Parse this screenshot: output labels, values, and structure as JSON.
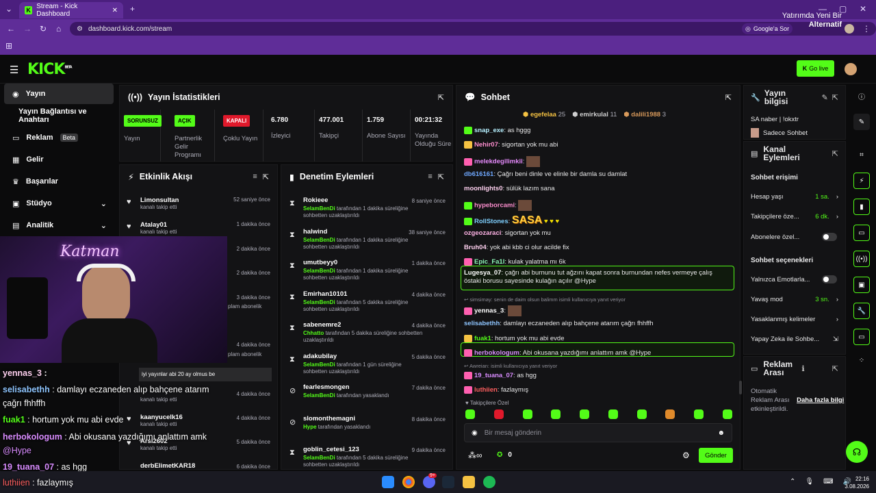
{
  "browser": {
    "tab_title": "Stream - Kick Dashboard",
    "url": "dashboard.kick.com/stream",
    "google_search": "Google'a Sor",
    "promo_line1": "Yatırımda Yeni Bir",
    "promo_line2": "Alternatif"
  },
  "header": {
    "logo": "KICK",
    "beta": "BETA",
    "go_live": "Go live"
  },
  "sidebar": {
    "items": [
      {
        "label": "Yayın"
      },
      {
        "label": "Yayın Bağlantısı ve Anahtarı"
      },
      {
        "label": "Reklam",
        "badge": "Beta"
      },
      {
        "label": "Gelir"
      },
      {
        "label": "Başarılar"
      },
      {
        "label": "Stüdyo"
      },
      {
        "label": "Analitik"
      }
    ]
  },
  "stats": {
    "title": "Yayın İstatistikleri",
    "cols": [
      {
        "value": "SORUNSUZ",
        "label": "Yayın"
      },
      {
        "value": "AÇIK",
        "label": "Partnerlik Gelir Programı"
      },
      {
        "value": "KAPALI",
        "label": "Çoklu Yayın"
      },
      {
        "value": "6.780",
        "label": "İzleyici"
      },
      {
        "value": "477.001",
        "label": "Takipçi"
      },
      {
        "value": "1.759",
        "label": "Abone Sayısı"
      },
      {
        "value": "00:21:32",
        "label": "Yayında Olduğu Süre"
      }
    ]
  },
  "activity": {
    "title": "Etkinlik Akışı",
    "items": [
      {
        "name": "Limonsultan",
        "sub": "kanalı takip etti",
        "time": "52 saniye önce"
      },
      {
        "name": "Atalay01",
        "sub": "kanalı takip etti",
        "time": "1 dakika önce"
      },
      {
        "time": "2 dakika önce"
      },
      {
        "time": "2 dakika önce"
      },
      {
        "time": "3 dakika önce",
        "sub": "plam abonelik"
      },
      {
        "time": "4 dakika önce",
        "sub": "plam abonelik"
      },
      {
        "name": "...",
        "sub": "kanalı takip etti",
        "time": "4 dakika önce"
      },
      {
        "name": "kaanyucelk16",
        "sub": "kanalı takip etti",
        "time": "4 dakika önce"
      },
      {
        "name": "Arsl2602",
        "sub": "kanalı takip etti",
        "time": "5 dakika önce"
      },
      {
        "name": "derbElimetKAR18",
        "time": "6 dakika önce"
      }
    ],
    "tooltip": "iyi yayınlar abi 20 ay olmus be"
  },
  "moderation": {
    "title": "Denetim Eylemleri",
    "items": [
      {
        "name": "Rokieee",
        "by": "SelamBenDi",
        "text": "tarafından 1 dakika süreliğine sohbetten uzaklaştırıldı",
        "time": "8 saniye önce",
        "icon": "hourglass"
      },
      {
        "name": "halwind",
        "by": "SelamBenDi",
        "text": "tarafından 1 dakika süreliğine sohbetten uzaklaştırıldı",
        "time": "38 saniye önce",
        "icon": "hourglass"
      },
      {
        "name": "umutbeyy0",
        "by": "SelamBenDi",
        "text": "tarafından 1 dakika süreliğine sohbetten uzaklaştırıldı",
        "time": "1 dakika önce",
        "icon": "hourglass"
      },
      {
        "name": "Emirhan10101",
        "by": "SelamBenDi",
        "text": "tarafından 5 dakika süreliğine sohbetten uzaklaştırıldı",
        "time": "4 dakika önce",
        "icon": "hourglass"
      },
      {
        "name": "sabenemre2",
        "by": "Chhatto",
        "text": "tarafından 5 dakika süreliğine sohbetten uzaklaştırıldı",
        "time": "4 dakika önce",
        "icon": "hourglass"
      },
      {
        "name": "adakubilay",
        "by": "SelamBenDi",
        "text": "tarafından 1 gün süreliğine sohbetten uzaklaştırıldı",
        "time": "5 dakika önce",
        "icon": "hourglass"
      },
      {
        "name": "fearlesmongen",
        "by": "SelamBenDi",
        "text": "tarafından yasaklandı",
        "time": "7 dakika önce",
        "icon": "ban"
      },
      {
        "name": "slomonthemagni",
        "by": "Hype",
        "text": "tarafından yasaklandı",
        "time": "8 dakika önce",
        "icon": "ban"
      },
      {
        "name": "goblin_cetesi_123",
        "by": "SelamBenDi",
        "text": "tarafından 5 dakika süreliğine sohbetten uzaklaştırıldı",
        "time": "9 dakika önce",
        "icon": "hourglass"
      }
    ]
  },
  "chat": {
    "title": "Sohbet",
    "top_gifters": [
      {
        "name": "egefelaa",
        "count": "25",
        "color": "#f5c242"
      },
      {
        "name": "emirkulal",
        "count": "11",
        "color": "#cfcfcf"
      },
      {
        "name": "dalili1988",
        "count": "3",
        "color": "#d99a5b"
      }
    ],
    "messages": [
      {
        "user": "snap_exe",
        "color": "#b6f0ff",
        "text": "as hggg",
        "badge": "#53fc18"
      },
      {
        "user": "Nehir07",
        "color": "#ff8fd0",
        "text": "sigortan yok mu abi",
        "badge": "#f5c242"
      },
      {
        "user": "melekdegilimkii",
        "color": "#e88cff",
        "text": "",
        "badge": "#ff5fb0"
      },
      {
        "user": "db616161",
        "color": "#6fa8ff",
        "text": "Çağrı beni dinle ve elinle bir damla su damlat"
      },
      {
        "user": "moonlights0",
        "color": "#ffd1f0",
        "text": "sülük lazım sana"
      },
      {
        "user": "hypeborcami",
        "color": "#ff8fd0",
        "text": "",
        "badge": "#53fc18"
      },
      {
        "user": "RollStones",
        "color": "#7fd0ff",
        "text": "SASA",
        "badge": "#53fc18"
      },
      {
        "user": "ozgeozaraci",
        "color": "#ffb3e6",
        "text": "sigortan yok mu"
      },
      {
        "user": "Bruh04",
        "color": "#ffd1f0",
        "text": "yok abi kbb ci olur acilde fix"
      },
      {
        "user": "Epic_Fa1l",
        "color": "#8cf7b6",
        "text": "kulak yalatma mı 6k",
        "badge": "#ff5fb0"
      },
      {
        "user": "Lugesya_07",
        "color": "#ffffff",
        "text": "çağrı abi burnunu tut ağzını kapat sonra burnundan nefes vermeye çalış östaki borusu sayesinde kulağın açılır @Hype"
      },
      {
        "user": "yennas_3",
        "color": "#ffffff",
        "text": "",
        "reply": "simsimay: senin de daim olsun balimm isimli kullanıcıya yanıt veriyor",
        "badge": "#ff5fb0"
      },
      {
        "user": "selisabethh",
        "color": "#8ec5ff",
        "text": "damlayı eczaneden alıp bahçene atarım çağrı fhhffh"
      },
      {
        "user": "fuak1",
        "color": "#53fc18",
        "text": "hortum yok mu abi evde",
        "badge": "#f5c242"
      },
      {
        "user": "herbokologum",
        "color": "#d98cff",
        "text": "Abi okusana yazdığımı anlattım amk @Hype",
        "badge": "#ff5fb0"
      },
      {
        "user": "19_tuana_07",
        "color": "#d98cff",
        "text": "as hgg",
        "reply": "Awreian: isimli kullanıcıya yanıt veriyor",
        "badge": "#ff5fb0"
      },
      {
        "user": "luthiien",
        "color": "#ff5f5f",
        "text": "fazlaymış",
        "badge": "#ff5fb0"
      }
    ],
    "emote_label": "Takipçilere Özel",
    "input_placeholder": "Bir mesaj gönderin",
    "points": "0",
    "send": "Gönder"
  },
  "stream_info": {
    "title": "Yayın bilgisi",
    "stream_title": "SA naber | !okxtr",
    "category": "Sadece Sohbet"
  },
  "channel_actions": {
    "title": "Kanal Eylemleri",
    "chat_access": "Sohbet erişimi",
    "account_age": {
      "label": "Hesap yaşı",
      "value": "1 sa."
    },
    "followers_only": {
      "label": "Takipçilere öze...",
      "value": "6 dk."
    },
    "subs_only": {
      "label": "Abonelere özel...",
      "on": false
    },
    "chat_options": "Sohbet seçenekleri",
    "emote_only": {
      "label": "Yalnızca Emotlarla...",
      "on": false
    },
    "slow_mode": {
      "label": "Yavaş mod",
      "value": "3 sn."
    },
    "banned_words": "Yasaklanmış kelimeler",
    "ai_mod": "Yapay Zeka ile Sohbe..."
  },
  "ads": {
    "title_line1": "Reklam",
    "title_line2": "Arası",
    "text1": "Otomatik",
    "text2": "Reklam Arası",
    "text3": "etkinleştirildi.",
    "link": "Daha fazla bilgi"
  },
  "overlay_chat": [
    {
      "user": "yennas_3",
      "color": "#ffd1f0",
      "text": ""
    },
    {
      "user": "selisabethh",
      "color": "#8ec5ff",
      "text": "damlayı eczaneden alıp bahçene atarım"
    },
    {
      "user": "",
      "color": "#ffffff",
      "text": "çağrı fhhffh"
    },
    {
      "user": "fuak1",
      "color": "#53fc18",
      "text": "hortum yok mu abi evde"
    },
    {
      "user": "herbokologum",
      "color": "#d98cff",
      "text": "Abi okusana yazdığımı anlattım amk"
    },
    {
      "user": "",
      "color": "#d98cff",
      "text": "@Hype"
    },
    {
      "user": "19_tuana_07",
      "color": "#d98cff",
      "text": "as hgg"
    },
    {
      "user": "luthiien",
      "color": "#ff5f5f",
      "text": "fazlaymış"
    }
  ],
  "webcam": {
    "neon_text": "Katman"
  },
  "taskbar": {
    "time": "22:16",
    "date": "3.08.2026",
    "discord_badge": "9+"
  },
  "colors": {
    "accent": "#53fc18",
    "panel": "#131315",
    "browser": "#5f2d98"
  }
}
